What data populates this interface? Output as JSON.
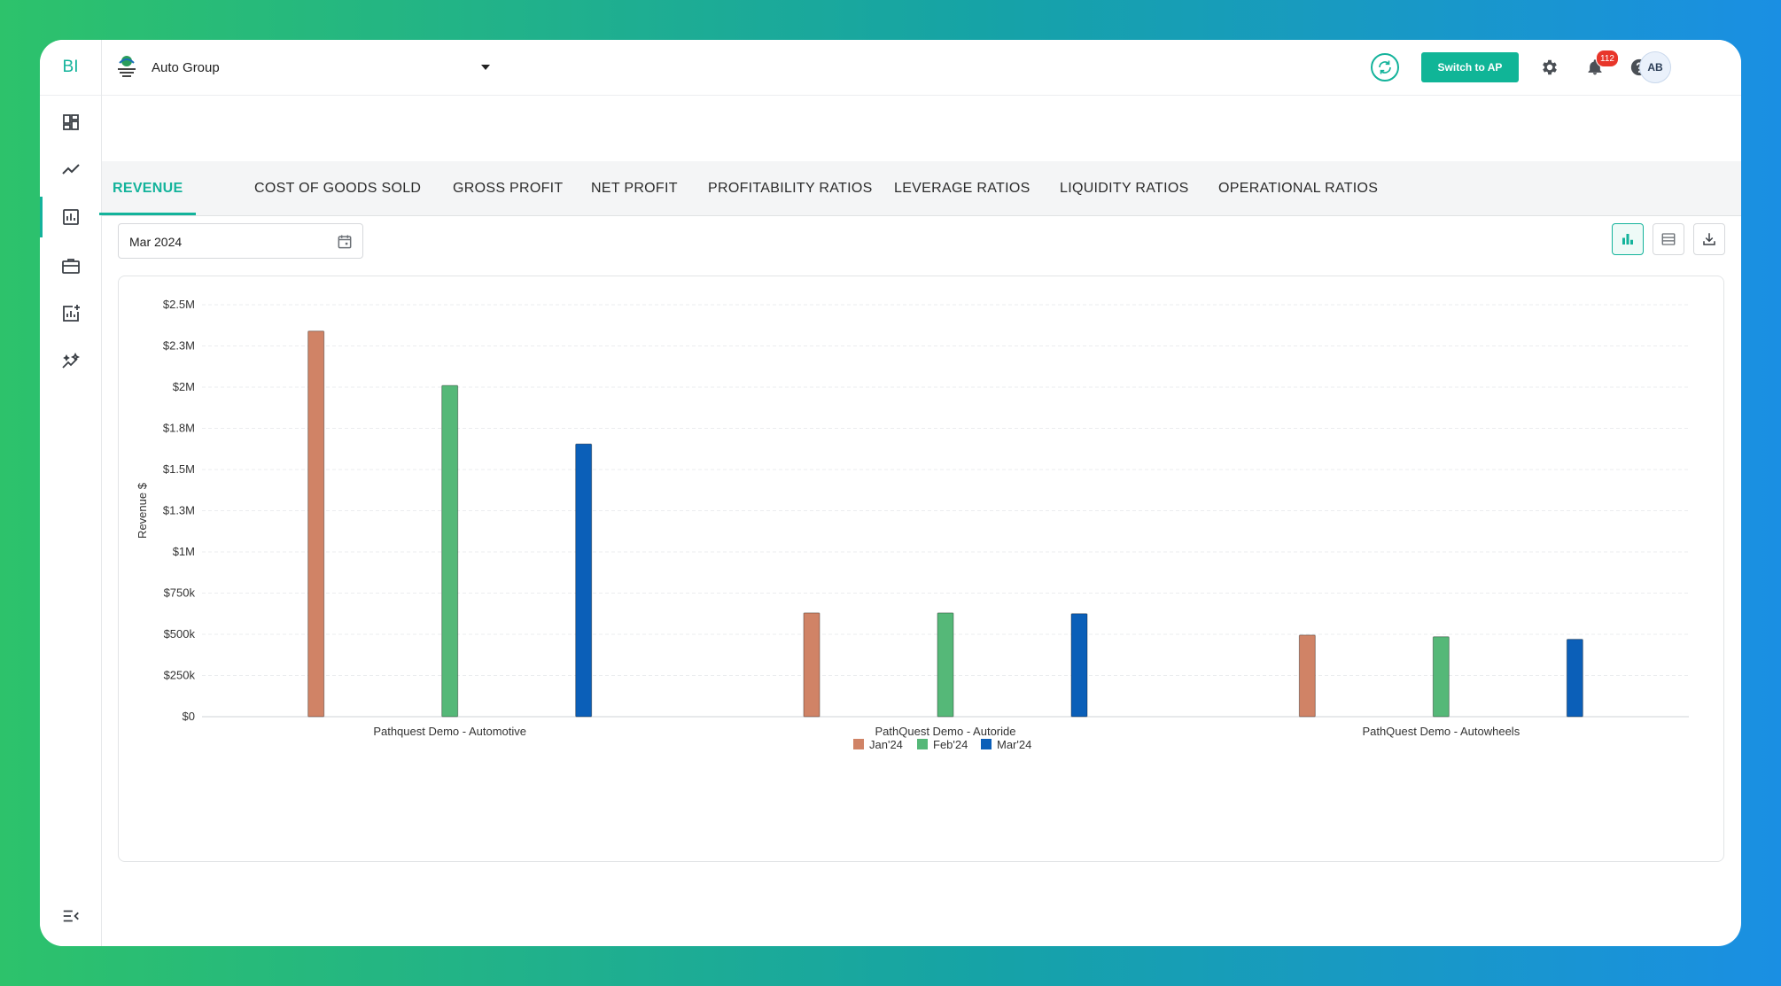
{
  "sidebar": {
    "brand": "BI",
    "items": [
      {
        "icon": "dashboard-icon"
      },
      {
        "icon": "trend-line-icon"
      },
      {
        "icon": "bar-report-icon",
        "active": true
      },
      {
        "icon": "briefcase-icon"
      },
      {
        "icon": "add-chart-icon"
      },
      {
        "icon": "insights-icon"
      }
    ],
    "collapse_icon": "menu-collapse-icon"
  },
  "header": {
    "org_name": "Auto Group",
    "switch_label": "Switch to AP",
    "notification_count": "112",
    "avatar_initials": "AB"
  },
  "tabs": [
    {
      "label": "REVENUE",
      "active": true
    },
    {
      "label": "COST OF GOODS SOLD"
    },
    {
      "label": "GROSS PROFIT"
    },
    {
      "label": "NET PROFIT"
    },
    {
      "label": "PROFITABILITY RATIOS"
    },
    {
      "label": "LEVERAGE RATIOS"
    },
    {
      "label": "LIQUIDITY RATIOS"
    },
    {
      "label": "OPERATIONAL RATIOS"
    }
  ],
  "filters": {
    "date_value": "Mar 2024"
  },
  "colors": {
    "accent": "#13b39b",
    "jan": "#d08366",
    "feb": "#55b878",
    "mar": "#0b5fb8"
  },
  "chart_data": {
    "type": "bar",
    "ylabel": "Revenue $",
    "ylim": [
      0,
      2500000
    ],
    "y_ticks": [
      "$0",
      "$250k",
      "$500k",
      "$750k",
      "$1M",
      "$1.3M",
      "$1.5M",
      "$1.8M",
      "$2M",
      "$2.3M",
      "$2.5M"
    ],
    "categories": [
      "Pathquest Demo - Automotive",
      "PathQuest Demo - Autoride",
      "PathQuest Demo - Autowheels"
    ],
    "series": [
      {
        "name": "Jan'24",
        "color": "#d08366",
        "values": [
          2340000,
          630000,
          495000
        ]
      },
      {
        "name": "Feb'24",
        "color": "#55b878",
        "values": [
          2010000,
          630000,
          485000
        ]
      },
      {
        "name": "Mar'24",
        "color": "#0b5fb8",
        "values": [
          1655000,
          625000,
          470000
        ]
      }
    ],
    "grid": true,
    "legend": "bottom-center"
  }
}
